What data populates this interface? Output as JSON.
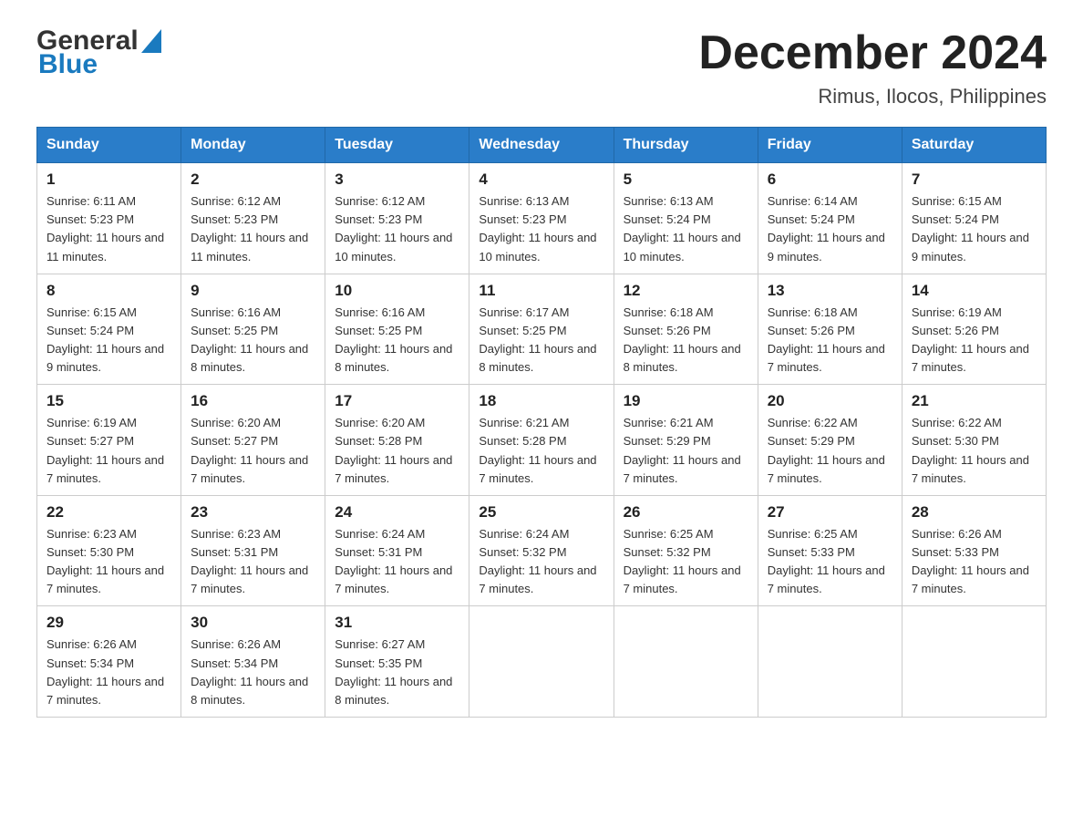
{
  "header": {
    "logo_general": "General",
    "logo_blue": "Blue",
    "month_year": "December 2024",
    "location": "Rimus, Ilocos, Philippines"
  },
  "weekdays": [
    "Sunday",
    "Monday",
    "Tuesday",
    "Wednesday",
    "Thursday",
    "Friday",
    "Saturday"
  ],
  "weeks": [
    [
      {
        "day": "1",
        "sunrise": "6:11 AM",
        "sunset": "5:23 PM",
        "daylight": "11 hours and 11 minutes."
      },
      {
        "day": "2",
        "sunrise": "6:12 AM",
        "sunset": "5:23 PM",
        "daylight": "11 hours and 11 minutes."
      },
      {
        "day": "3",
        "sunrise": "6:12 AM",
        "sunset": "5:23 PM",
        "daylight": "11 hours and 10 minutes."
      },
      {
        "day": "4",
        "sunrise": "6:13 AM",
        "sunset": "5:23 PM",
        "daylight": "11 hours and 10 minutes."
      },
      {
        "day": "5",
        "sunrise": "6:13 AM",
        "sunset": "5:24 PM",
        "daylight": "11 hours and 10 minutes."
      },
      {
        "day": "6",
        "sunrise": "6:14 AM",
        "sunset": "5:24 PM",
        "daylight": "11 hours and 9 minutes."
      },
      {
        "day": "7",
        "sunrise": "6:15 AM",
        "sunset": "5:24 PM",
        "daylight": "11 hours and 9 minutes."
      }
    ],
    [
      {
        "day": "8",
        "sunrise": "6:15 AM",
        "sunset": "5:24 PM",
        "daylight": "11 hours and 9 minutes."
      },
      {
        "day": "9",
        "sunrise": "6:16 AM",
        "sunset": "5:25 PM",
        "daylight": "11 hours and 8 minutes."
      },
      {
        "day": "10",
        "sunrise": "6:16 AM",
        "sunset": "5:25 PM",
        "daylight": "11 hours and 8 minutes."
      },
      {
        "day": "11",
        "sunrise": "6:17 AM",
        "sunset": "5:25 PM",
        "daylight": "11 hours and 8 minutes."
      },
      {
        "day": "12",
        "sunrise": "6:18 AM",
        "sunset": "5:26 PM",
        "daylight": "11 hours and 8 minutes."
      },
      {
        "day": "13",
        "sunrise": "6:18 AM",
        "sunset": "5:26 PM",
        "daylight": "11 hours and 7 minutes."
      },
      {
        "day": "14",
        "sunrise": "6:19 AM",
        "sunset": "5:26 PM",
        "daylight": "11 hours and 7 minutes."
      }
    ],
    [
      {
        "day": "15",
        "sunrise": "6:19 AM",
        "sunset": "5:27 PM",
        "daylight": "11 hours and 7 minutes."
      },
      {
        "day": "16",
        "sunrise": "6:20 AM",
        "sunset": "5:27 PM",
        "daylight": "11 hours and 7 minutes."
      },
      {
        "day": "17",
        "sunrise": "6:20 AM",
        "sunset": "5:28 PM",
        "daylight": "11 hours and 7 minutes."
      },
      {
        "day": "18",
        "sunrise": "6:21 AM",
        "sunset": "5:28 PM",
        "daylight": "11 hours and 7 minutes."
      },
      {
        "day": "19",
        "sunrise": "6:21 AM",
        "sunset": "5:29 PM",
        "daylight": "11 hours and 7 minutes."
      },
      {
        "day": "20",
        "sunrise": "6:22 AM",
        "sunset": "5:29 PM",
        "daylight": "11 hours and 7 minutes."
      },
      {
        "day": "21",
        "sunrise": "6:22 AM",
        "sunset": "5:30 PM",
        "daylight": "11 hours and 7 minutes."
      }
    ],
    [
      {
        "day": "22",
        "sunrise": "6:23 AM",
        "sunset": "5:30 PM",
        "daylight": "11 hours and 7 minutes."
      },
      {
        "day": "23",
        "sunrise": "6:23 AM",
        "sunset": "5:31 PM",
        "daylight": "11 hours and 7 minutes."
      },
      {
        "day": "24",
        "sunrise": "6:24 AM",
        "sunset": "5:31 PM",
        "daylight": "11 hours and 7 minutes."
      },
      {
        "day": "25",
        "sunrise": "6:24 AM",
        "sunset": "5:32 PM",
        "daylight": "11 hours and 7 minutes."
      },
      {
        "day": "26",
        "sunrise": "6:25 AM",
        "sunset": "5:32 PM",
        "daylight": "11 hours and 7 minutes."
      },
      {
        "day": "27",
        "sunrise": "6:25 AM",
        "sunset": "5:33 PM",
        "daylight": "11 hours and 7 minutes."
      },
      {
        "day": "28",
        "sunrise": "6:26 AM",
        "sunset": "5:33 PM",
        "daylight": "11 hours and 7 minutes."
      }
    ],
    [
      {
        "day": "29",
        "sunrise": "6:26 AM",
        "sunset": "5:34 PM",
        "daylight": "11 hours and 7 minutes."
      },
      {
        "day": "30",
        "sunrise": "6:26 AM",
        "sunset": "5:34 PM",
        "daylight": "11 hours and 8 minutes."
      },
      {
        "day": "31",
        "sunrise": "6:27 AM",
        "sunset": "5:35 PM",
        "daylight": "11 hours and 8 minutes."
      },
      null,
      null,
      null,
      null
    ]
  ],
  "labels": {
    "sunrise": "Sunrise:",
    "sunset": "Sunset:",
    "daylight": "Daylight:"
  }
}
